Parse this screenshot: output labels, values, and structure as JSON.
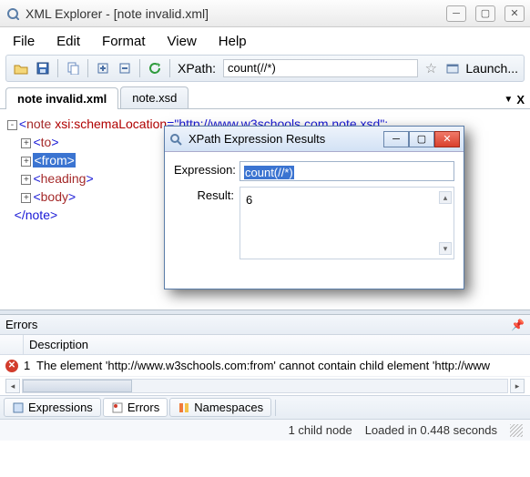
{
  "window": {
    "title": "XML Explorer - [note invalid.xml]"
  },
  "menu": {
    "file": "File",
    "edit": "Edit",
    "format": "Format",
    "view": "View",
    "help": "Help"
  },
  "toolbar": {
    "xpath_label": "XPath:",
    "xpath_value": "count(//*)",
    "launch": "Launch..."
  },
  "tabs": {
    "active": "note invalid.xml",
    "second": "note.xsd"
  },
  "xml": {
    "note_open1": "<",
    "note_tag": "note",
    "note_attr_name": "xsi:schemaLocation",
    "note_attr_eq": "=",
    "note_attr_val": "\"http://www.w3schools.com note.xsd\"",
    "to_open": "<",
    "to_tag": "to",
    "to_close": ">",
    "from_open": "<",
    "from_tag": "from",
    "from_close": ">",
    "heading_open": "<",
    "heading_tag": "heading",
    "heading_close": ">",
    "body_open": "<",
    "body_tag": "body",
    "body_close": ">",
    "note_close": "</note>"
  },
  "dialog": {
    "title": "XPath Expression Results",
    "expr_label": "Expression:",
    "expr_value": "count(//*)",
    "result_label": "Result:",
    "result_value": "6"
  },
  "errors": {
    "panel_title": "Errors",
    "col_desc": "Description",
    "row1_num": "1",
    "row1_text": "The element 'http://www.w3schools.com:from' cannot contain child element 'http://www"
  },
  "bottom_tabs": {
    "expressions": "Expressions",
    "errors": "Errors",
    "namespaces": "Namespaces"
  },
  "status": {
    "nodes": "1 child node",
    "loaded": "Loaded in 0.448 seconds"
  }
}
